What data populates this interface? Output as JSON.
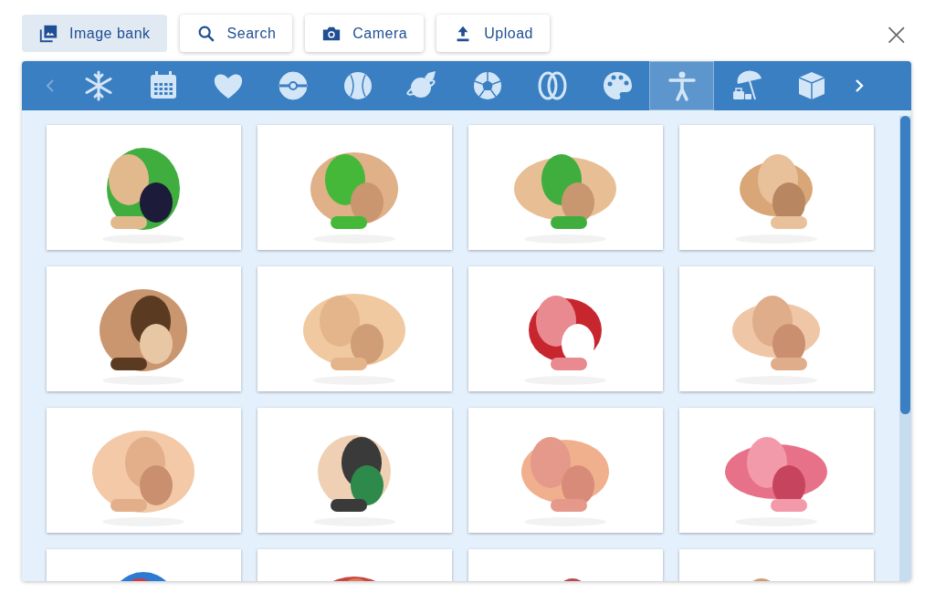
{
  "source_tabs": [
    {
      "label": "Image bank",
      "selected": true
    },
    {
      "label": "Search",
      "selected": false
    },
    {
      "label": "Camera",
      "selected": false
    },
    {
      "label": "Upload",
      "selected": false
    }
  ],
  "close_button": {
    "label": "×"
  },
  "category_bar": {
    "prev_disabled": true,
    "next_disabled": false,
    "categories": [
      {
        "kind": "snowflake",
        "selected": false
      },
      {
        "kind": "calendar",
        "selected": false
      },
      {
        "kind": "heart",
        "selected": false
      },
      {
        "kind": "disc",
        "selected": false
      },
      {
        "kind": "baseball",
        "selected": false
      },
      {
        "kind": "planet",
        "selected": false
      },
      {
        "kind": "soccer",
        "selected": false
      },
      {
        "kind": "rings",
        "selected": false
      },
      {
        "kind": "palette",
        "selected": false
      },
      {
        "kind": "person",
        "selected": true
      },
      {
        "kind": "beach",
        "selected": false
      },
      {
        "kind": "cube",
        "selected": false
      }
    ]
  }
}
